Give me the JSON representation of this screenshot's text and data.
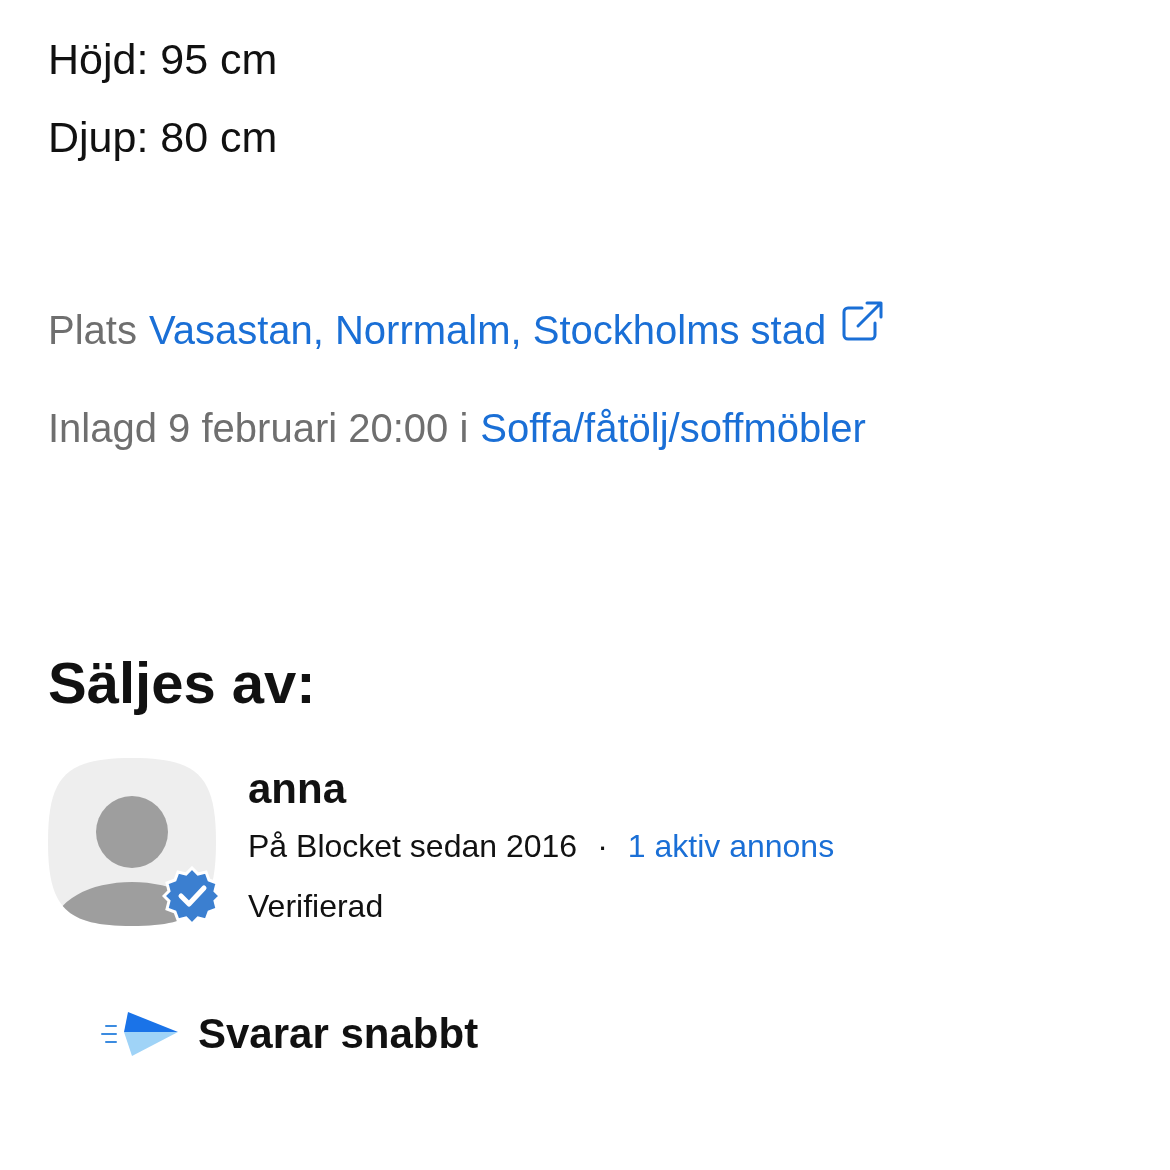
{
  "specs": [
    "Höjd: 95 cm",
    "Djup: 80 cm"
  ],
  "location": {
    "label": "Plats",
    "link": "Vasastan, Norrmalm, Stockholms stad"
  },
  "posted": {
    "text": "Inlagd 9 februari 20:00 i",
    "category": "Soffa/fåtölj/soffmöbler"
  },
  "seller": {
    "heading": "Säljes av:",
    "name": "anna",
    "verified": true,
    "member_since": "På Blocket sedan 2016",
    "separator": "·",
    "active_ads": "1 aktiv annons",
    "verified_label": "Verifierad"
  },
  "response": {
    "label": "Svarar snabbt"
  }
}
